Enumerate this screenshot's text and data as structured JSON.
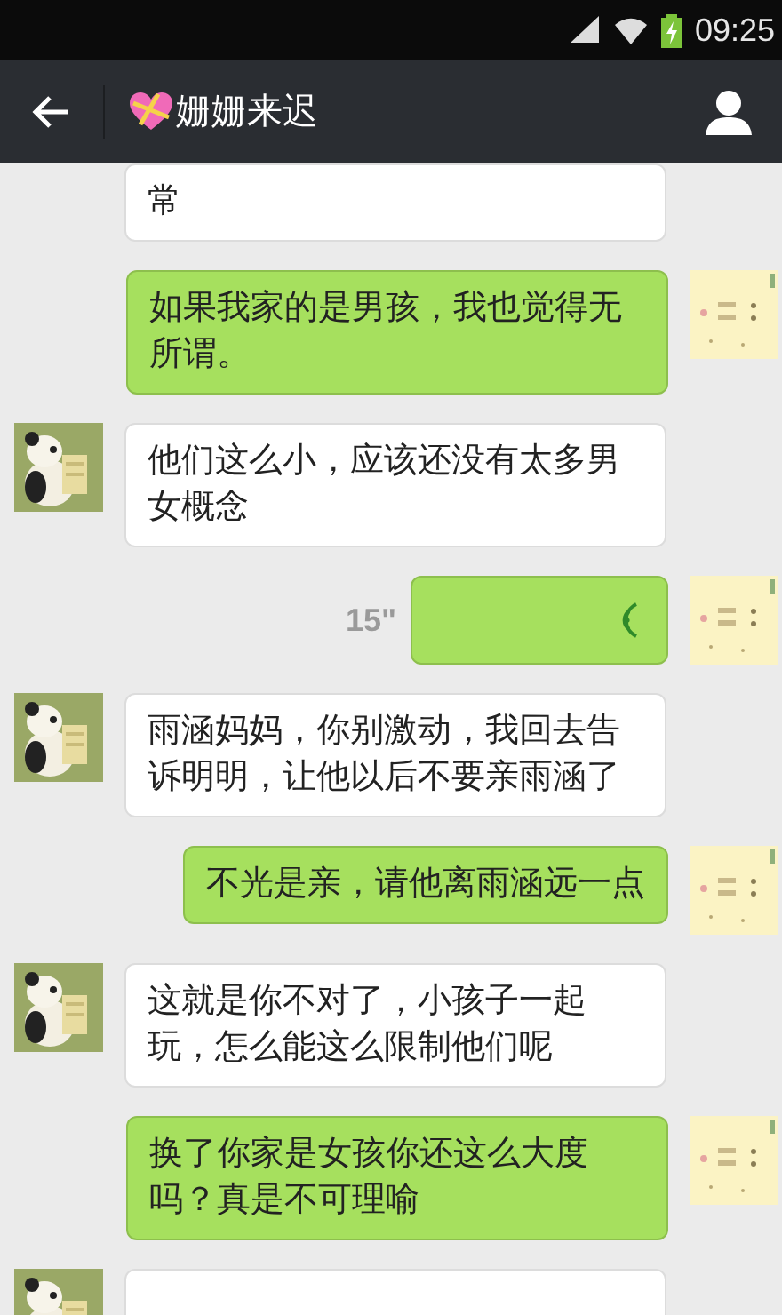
{
  "status_bar": {
    "time": "09:25"
  },
  "header": {
    "title": "姗姗来迟"
  },
  "messages": [
    {
      "sent": false,
      "kind": "cut_text",
      "text": "常"
    },
    {
      "sent": true,
      "kind": "text",
      "text": "如果我家的是男孩，我也觉得无所谓。"
    },
    {
      "sent": false,
      "kind": "text",
      "text": "他们这么小，应该还没有太多男女概念"
    },
    {
      "sent": true,
      "kind": "voice",
      "duration": "15\""
    },
    {
      "sent": false,
      "kind": "text",
      "text": "雨涵妈妈，你别激动，我回去告诉明明，让他以后不要亲雨涵了"
    },
    {
      "sent": true,
      "kind": "text",
      "text": "不光是亲，请他离雨涵远一点"
    },
    {
      "sent": false,
      "kind": "text",
      "text": "这就是你不对了，小孩子一起玩，怎么能这么限制他们呢"
    },
    {
      "sent": true,
      "kind": "text",
      "text": "换了你家是女孩你还这么大度吗？真是不可理喻"
    },
    {
      "sent": false,
      "kind": "partial"
    }
  ]
}
